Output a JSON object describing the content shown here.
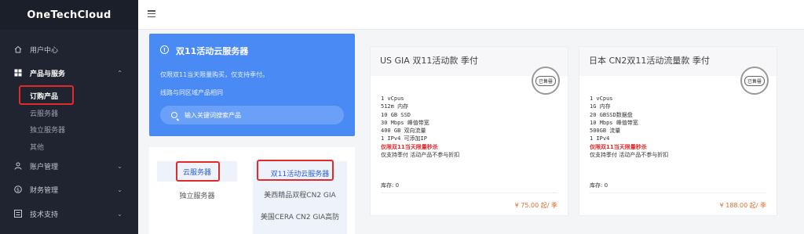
{
  "brand": "OneTechCloud",
  "sidebar": {
    "items": [
      {
        "label": "用户中心",
        "icon": "home-icon"
      },
      {
        "label": "产品与服务",
        "icon": "grid-icon",
        "chevron": "⌃"
      },
      {
        "label": "账户管理",
        "icon": "user-icon",
        "chevron": "⌄"
      },
      {
        "label": "财务管理",
        "icon": "dollar-icon",
        "chevron": "⌄"
      },
      {
        "label": "技术支持",
        "icon": "list-icon",
        "chevron": "⌄"
      }
    ],
    "sub_items": [
      "订购产品",
      "云服务器",
      "独立服务器",
      "其他"
    ]
  },
  "promo": {
    "icon": "info-icon",
    "title": "双11活动云服务器",
    "line1": "仅限双11当天限量购买，仅支持季付。",
    "line2": "线路与同区域产品相同",
    "search_placeholder": "输入关键词搜索产品"
  },
  "categories": {
    "left": [
      "云服务器",
      "独立服务器"
    ],
    "right": [
      "双11活动云服务器",
      "美西精品双程CN2 GIA",
      "美国CERA CN2 GIA高防"
    ]
  },
  "cards": [
    {
      "title": "US GIA 双11活动款 季付",
      "stamp": "已售罄",
      "specs": [
        "1 vCpus",
        "512m 内存",
        "10 GB SSD",
        "30 Mbps 峰值带宽",
        "400 GB 双向流量",
        "1 IPv4 可添加IP"
      ],
      "hot": "仅限双11当天限量秒杀",
      "note": "仅支持季付 活动产品不参与折扣",
      "stock": "库存:  0",
      "price": "¥ 75.00 起/ 季"
    },
    {
      "title": "日本 CN2双11活动流量款 季付",
      "stamp": "已售罄",
      "specs": [
        "1 vCpus",
        "1G 内存",
        "20 GBSSD数据盘",
        "10 Mbps 峰值带宽",
        "500GB 流量",
        "1 IPv4"
      ],
      "hot": "仅限双11当天限量秒杀",
      "note": "仅支持季付 活动产品不参与折扣",
      "stock": "库存:  0",
      "price": "¥ 188.00 起/ 季"
    }
  ],
  "colors": {
    "sidebar_bg": "#1f2430",
    "promo_blue": "#4a8af4",
    "highlight_red": "#e12a2a",
    "price_orange": "#e26b2a"
  }
}
